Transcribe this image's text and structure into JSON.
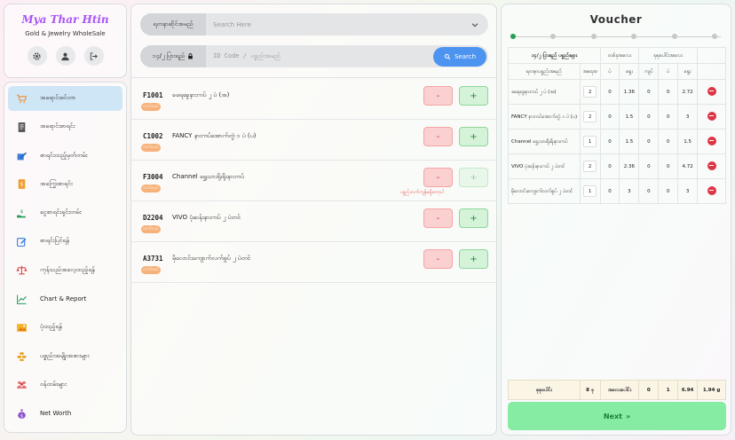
{
  "brand": {
    "title": "Mya Thar Htin",
    "subtitle": "Gold & Jewelry WholeSale"
  },
  "sidebar": {
    "items": [
      {
        "label": "အရောင်းစင်တာ",
        "icon": "cart-icon",
        "active": true
      },
      {
        "label": "အရောင်းစာရင်း",
        "icon": "receipt-icon"
      },
      {
        "label": "စာရင်းထည့်မှတ်တမ်း",
        "icon": "edit-icon"
      },
      {
        "label": "အကြွေးစာရင်း",
        "icon": "dollar-doc-icon"
      },
      {
        "label": "ငွေစာရင်းရှင်းတမ်း",
        "icon": "hand-money-icon"
      },
      {
        "label": "စာရင်းပြင်ရန်",
        "icon": "pencil-square-icon"
      },
      {
        "label": "ကုန်သည်အလေ့ထည့်ရန်",
        "icon": "scale-icon"
      },
      {
        "label": "Chart & Report",
        "icon": "line-chart-icon"
      },
      {
        "label": "ပုံထည့်ရန်",
        "icon": "image-icon"
      },
      {
        "label": "ပစ္စည်းအမျိုးအစားများ",
        "icon": "gold-bars-icon"
      },
      {
        "label": "ဝန်ထမ်းများ",
        "icon": "users-icon"
      },
      {
        "label": "Net Worth",
        "icon": "money-bag-icon"
      }
    ]
  },
  "search": {
    "row1_label": "ရတနာဆိုင်အမည်",
    "row1_placeholder": "Search Here",
    "row2_label": "၁၄/၂ ပြားရည်",
    "row2_placeholder": "ID Code / ပစ္စည်းအမည်",
    "button_label": "Search"
  },
  "items": [
    {
      "code": "F1001",
      "name": "ခရေခွေနားကပ် ၂ ပဲ (အ)",
      "tag": "လက်ဝယ်"
    },
    {
      "code": "C1002",
      "name": "FANCY နားကပ်အောက်တွဲ ၁ ပဲ (ပ)",
      "tag": "လက်ဝယ်"
    },
    {
      "code": "F3004",
      "name": "Channel ရွှေသားရိုးရိုးနားကပ်",
      "tag": "လက်ဝယ်",
      "warning": "ပစ္စည်းလက်ကျန်မရှိတော့ပါ",
      "plus_disabled": true
    },
    {
      "code": "D2204",
      "name": "VIVO ပုံဆန်းနားကပ် ၂ ပဲတင်",
      "tag": "လက်ဝယ်"
    },
    {
      "code": "A3731",
      "name": "မိုလောင်းကျောက်လက်စွပ် ၂ ပဲတင်",
      "tag": "လက်ဝယ်"
    }
  ],
  "voucher": {
    "title": "Voucher",
    "steps": [
      true,
      false,
      false,
      false,
      false,
      false,
      false
    ],
    "header": {
      "group_item": "၁၄/၂ ပြားရည် ပစ္စည်းများ",
      "group_unit": "တစ်ခုအလေး",
      "group_total": "စုစုပေါင်းအလေး",
      "col_name": "ရတနာပစ္စည်းအမည်",
      "col_qty": "အရေအ",
      "col_kyat": "ပဲ",
      "col_yway": "ရွေး",
      "col_tkyat": "ကျပ်",
      "col_tpe": "ပဲ",
      "col_tyway": "ရွေး"
    },
    "rows": [
      {
        "name": "ခရေခွေနားကပ် ၂ ပဲ (အ)",
        "qty": "2",
        "kyat": "0",
        "yway": "1.36",
        "tk": "0",
        "tp": "0",
        "ty": "2.72"
      },
      {
        "name": "FANCY နားကပ်အောက်တွဲ ၁ ပဲ (ပ)",
        "qty": "2",
        "kyat": "0",
        "yway": "1.5",
        "tk": "0",
        "tp": "0",
        "ty": "3"
      },
      {
        "name": "Channel ရွှေသားရိုးရိုးနားကပ်",
        "qty": "1",
        "kyat": "0",
        "yway": "1.5",
        "tk": "0",
        "tp": "0",
        "ty": "1.5"
      },
      {
        "name": "VIVO ပုံဆန်းနားကပ် ၂ ပဲတင်",
        "qty": "2",
        "kyat": "0",
        "yway": "2.36",
        "tk": "0",
        "tp": "0",
        "ty": "4.72"
      },
      {
        "name": "မိုလောင်းကျောက်လက်စွပ် ၂ ပဲတင်",
        "qty": "1",
        "kyat": "0",
        "yway": "3",
        "tk": "0",
        "tp": "0",
        "ty": "3"
      }
    ],
    "totals": {
      "label": "စုစုပေါင်း",
      "count": "8 ခု",
      "weight_label": "အလေးပေါင်း",
      "tk": "0",
      "tp": "1",
      "ty": "6.94",
      "grams": "1.94 g"
    },
    "next_label": "Next",
    "next_icon": "»"
  }
}
